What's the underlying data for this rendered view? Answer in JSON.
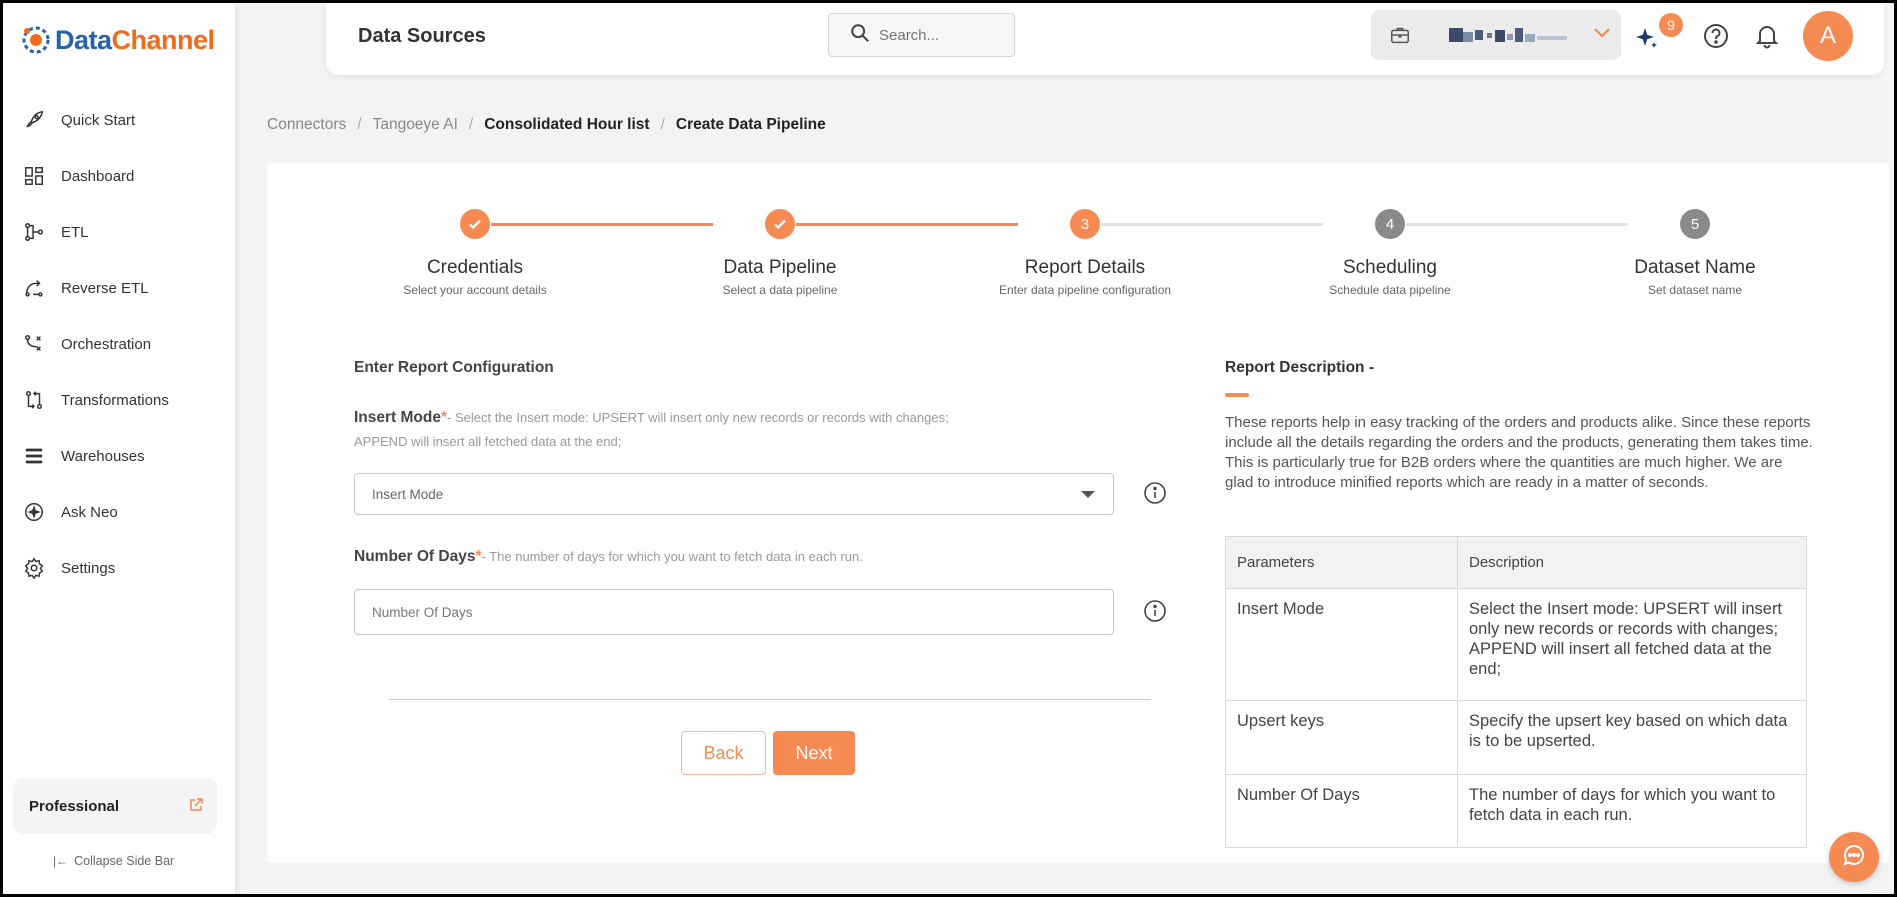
{
  "app": {
    "logo_text_a": "Data",
    "logo_text_b": "Channel"
  },
  "sidebar": {
    "items": [
      {
        "label": "Quick Start",
        "icon": "rocket-icon"
      },
      {
        "label": "Dashboard",
        "icon": "dashboard-icon"
      },
      {
        "label": "ETL",
        "icon": "etl-icon"
      },
      {
        "label": "Reverse ETL",
        "icon": "reverse-etl-icon"
      },
      {
        "label": "Orchestration",
        "icon": "orchestration-icon"
      },
      {
        "label": "Transformations",
        "icon": "transformations-icon"
      },
      {
        "label": "Warehouses",
        "icon": "warehouses-icon"
      },
      {
        "label": "Ask Neo",
        "icon": "ask-neo-icon"
      },
      {
        "label": "Settings",
        "icon": "gear-icon"
      }
    ],
    "plan": "Professional",
    "collapse_label": "Collapse Side Bar"
  },
  "header": {
    "title": "Data Sources",
    "search_placeholder": "Search...",
    "notifications_count": "9",
    "avatar_initial": "A"
  },
  "breadcrumbs": [
    "Connectors",
    "Tangoeye AI",
    "Consolidated Hour list",
    "Create Data Pipeline"
  ],
  "steps": [
    {
      "title": "Credentials",
      "subtitle": "Select your account details",
      "status": "done",
      "number": "1"
    },
    {
      "title": "Data Pipeline",
      "subtitle": "Select a data pipeline",
      "status": "done",
      "number": "2"
    },
    {
      "title": "Report Details",
      "subtitle": "Enter data pipeline configuration",
      "status": "active",
      "number": "3"
    },
    {
      "title": "Scheduling",
      "subtitle": "Schedule data pipeline",
      "status": "todo",
      "number": "4"
    },
    {
      "title": "Dataset Name",
      "subtitle": "Set dataset name",
      "status": "todo",
      "number": "5"
    }
  ],
  "form": {
    "title": "Enter Report Configuration",
    "insert_mode": {
      "label": "Insert Mode",
      "required": "*",
      "hint_line1": "- Select the Insert mode: UPSERT will insert only new records or records with changes;",
      "hint_line2": "APPEND will insert all fetched data at the end;",
      "placeholder": "Insert Mode"
    },
    "number_of_days": {
      "label": "Number Of Days",
      "required": "*",
      "hint": "- The number of days for which you want to fetch data in each run.",
      "placeholder": "Number Of Days"
    },
    "back_label": "Back",
    "next_label": "Next"
  },
  "description": {
    "title": "Report Description -",
    "text": "These reports help in easy tracking of the orders and products alike. Since these reports include all the details regarding the orders and the products, generating them takes time. This is particularly true for B2B orders where the quantities are much higher. We are glad to introduce minified reports which are ready in a matter of seconds.",
    "table_headers": [
      "Parameters",
      "Description"
    ],
    "rows": [
      {
        "param": "Insert Mode",
        "desc": "Select the Insert mode: UPSERT will insert only new records or records with changes; APPEND will insert all fetched data at the end;"
      },
      {
        "param": "Upsert keys",
        "desc": "Specify the upsert key based on which data is to be upserted."
      },
      {
        "param": "Number Of Days",
        "desc": "The number of days for which you want to fetch data in each run."
      }
    ]
  },
  "colors": {
    "accent": "#f58a52",
    "brand_blue": "#2563a8",
    "brand_orange": "#f26b1d",
    "step_todo": "#8a8a8a"
  }
}
